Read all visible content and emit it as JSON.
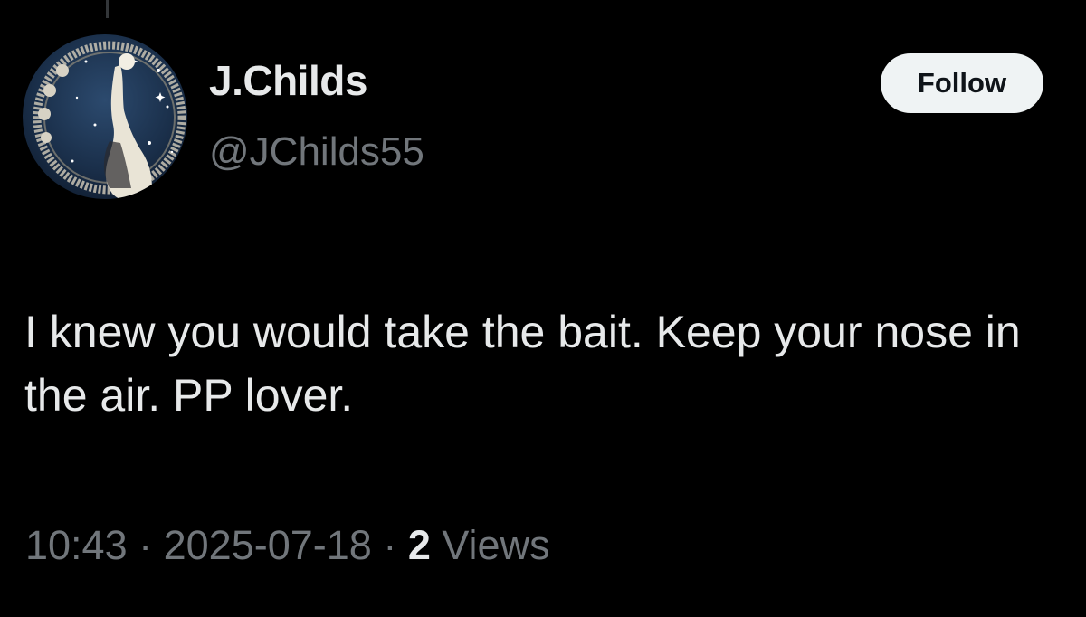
{
  "author": {
    "display_name": "J.Childs",
    "handle": "@JChilds55"
  },
  "follow_button": {
    "label": "Follow"
  },
  "tweet": {
    "text": "I knew you would take the bait. Keep your nose in the air. PP lover."
  },
  "meta": {
    "time": "10:43",
    "separator": " · ",
    "date": "2025-07-18",
    "views_count": "2",
    "views_label": "Views"
  },
  "colors": {
    "background": "#000000",
    "primary_text": "#e7e9ea",
    "secondary_text": "#71767b",
    "button_bg": "#eff3f4",
    "button_text": "#0f1419"
  },
  "icons": {
    "avatar": "profile-avatar-night-sky-figure"
  }
}
